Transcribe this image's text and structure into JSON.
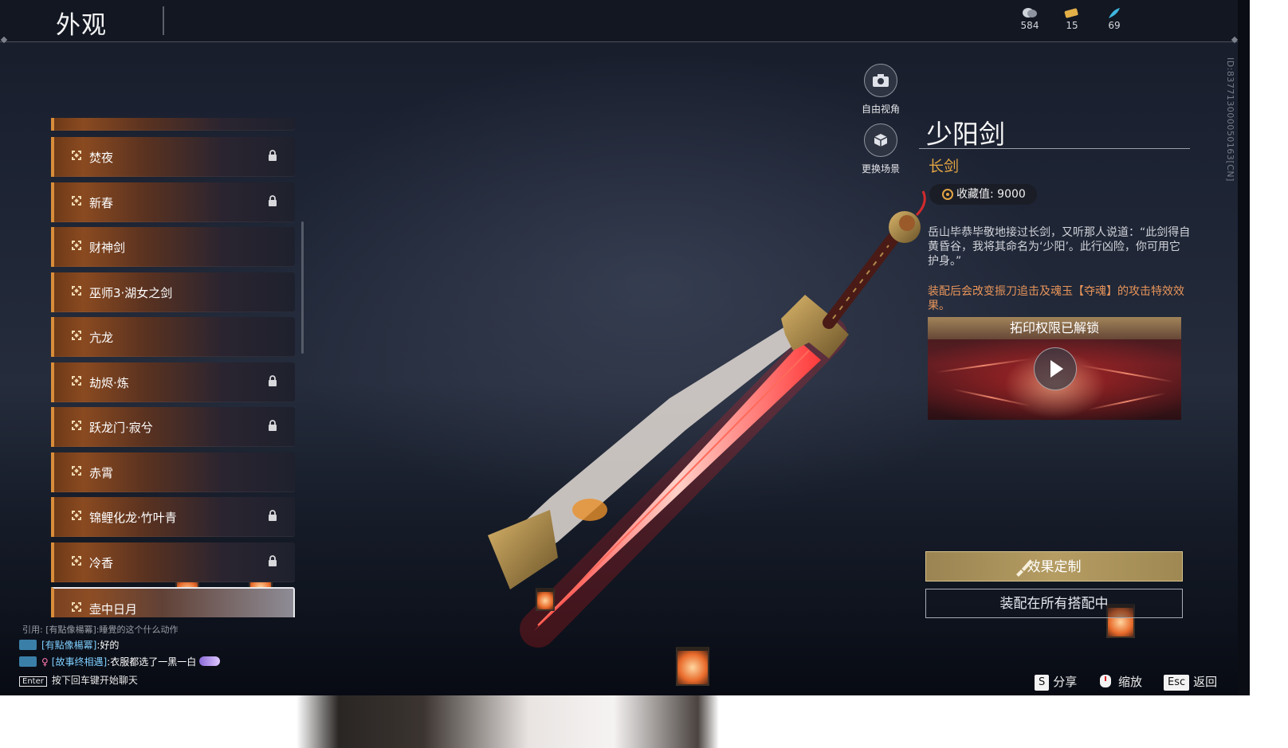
{
  "header": {
    "title": "外观",
    "currencies": [
      {
        "icon": "coins-icon",
        "value": "584"
      },
      {
        "icon": "ticket-icon",
        "value": "15"
      },
      {
        "icon": "feather-icon",
        "value": "69"
      }
    ]
  },
  "side_id": "ID:837713000050163[CN]",
  "camera": {
    "free_view": "自由视角",
    "change_scene": "更换场景"
  },
  "list": {
    "items": [
      {
        "label": "焚夜",
        "locked": true
      },
      {
        "label": "新春",
        "locked": true
      },
      {
        "label": "财神剑",
        "locked": false
      },
      {
        "label": "巫师3·湖女之剑",
        "locked": false
      },
      {
        "label": "亢龙",
        "locked": false
      },
      {
        "label": "劫烬·炼",
        "locked": true
      },
      {
        "label": "跃龙门·寂兮",
        "locked": true
      },
      {
        "label": "赤霄",
        "locked": false
      },
      {
        "label": "锦鲤化龙·竹叶青",
        "locked": true
      },
      {
        "label": "冷香",
        "locked": true
      },
      {
        "label": "壶中日月",
        "locked": false,
        "selected": true
      }
    ]
  },
  "detail": {
    "name": "少阳剑",
    "type": "长剑",
    "collect_label": "收藏值: 9000",
    "description": "岳山毕恭毕敬地接过长剑，又听那人说道：“此剑得自黄昏谷，我将其命名为‘少阳’。此行凶险，你可用它护身。”",
    "effect_note": "装配后会改变振刀追击及魂玉【夺魂】的攻击特效效果。",
    "video_title": "拓印权限已解锁",
    "customize_button": "效果定制",
    "equip_button": "装配在所有搭配中"
  },
  "hints": {
    "share_key": "S",
    "share": "分享",
    "zoom": "缩放",
    "back_key": "Esc",
    "back": "返回"
  },
  "chat": {
    "quote": "引用: [有點像楊冪]:睡覺的这个什么动作",
    "lines": [
      {
        "name": "[有點像楊冪]",
        "text": ":好的"
      },
      {
        "name": "[故事终相遇]",
        "text": ":衣服都选了一黑一白"
      }
    ],
    "enter_key": "Enter",
    "prompt": "按下回车键开始聊天"
  },
  "colors": {
    "accent_orange": "#d98d3a",
    "type_gold": "#e3a544",
    "effect_orange": "#e8955a",
    "button_gold": "#b49c62"
  }
}
